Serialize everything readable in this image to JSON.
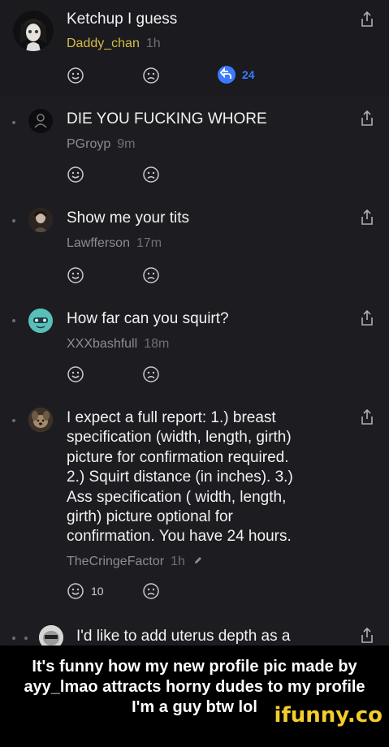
{
  "comments": [
    {
      "text": "Ketchup I guess",
      "user": "Daddy_chan",
      "time": "1h",
      "replies": "24",
      "avatar": "anime-avatar-icon"
    },
    {
      "text": "DIE YOU FUCKING WHORE",
      "user": "PGroyp",
      "time": "9m",
      "avatar": "default-user-avatar-icon"
    },
    {
      "text": "Show me your tits",
      "user": "Lawfferson",
      "time": "17m",
      "avatar": "photo-avatar-icon"
    },
    {
      "text": "How far can you squirt?",
      "user": "XXXbashfull",
      "time": "18m",
      "avatar": "frog-avatar-icon"
    },
    {
      "lines": [
        "I expect a full report: 1.) breast",
        "specification (width, length, girth)",
        "picture for confirmation required.",
        "2.) Squirt distance (in inches). 3.)",
        "Ass specification ( width, length,",
        "girth) picture optional for",
        "confirmation. You have 24 hours."
      ],
      "user": "TheCringeFactor",
      "time": "1h",
      "likes": "10",
      "avatar": "dog-avatar-icon"
    },
    {
      "text": "I'd like to add uterus depth as a",
      "avatar": "meme-avatar-icon"
    }
  ],
  "caption": {
    "line1": "It's funny how my new profile pic made by",
    "line2": "ayy_lmao attracts horny dudes to my profile",
    "line3": "I'm a guy btw lol"
  },
  "watermark": "ifunny.co",
  "colors": {
    "background": "#1d1d21",
    "username_gold": "#d8bd45",
    "reply_blue": "#3a7bff",
    "watermark_yellow": "#f3cd2d"
  }
}
